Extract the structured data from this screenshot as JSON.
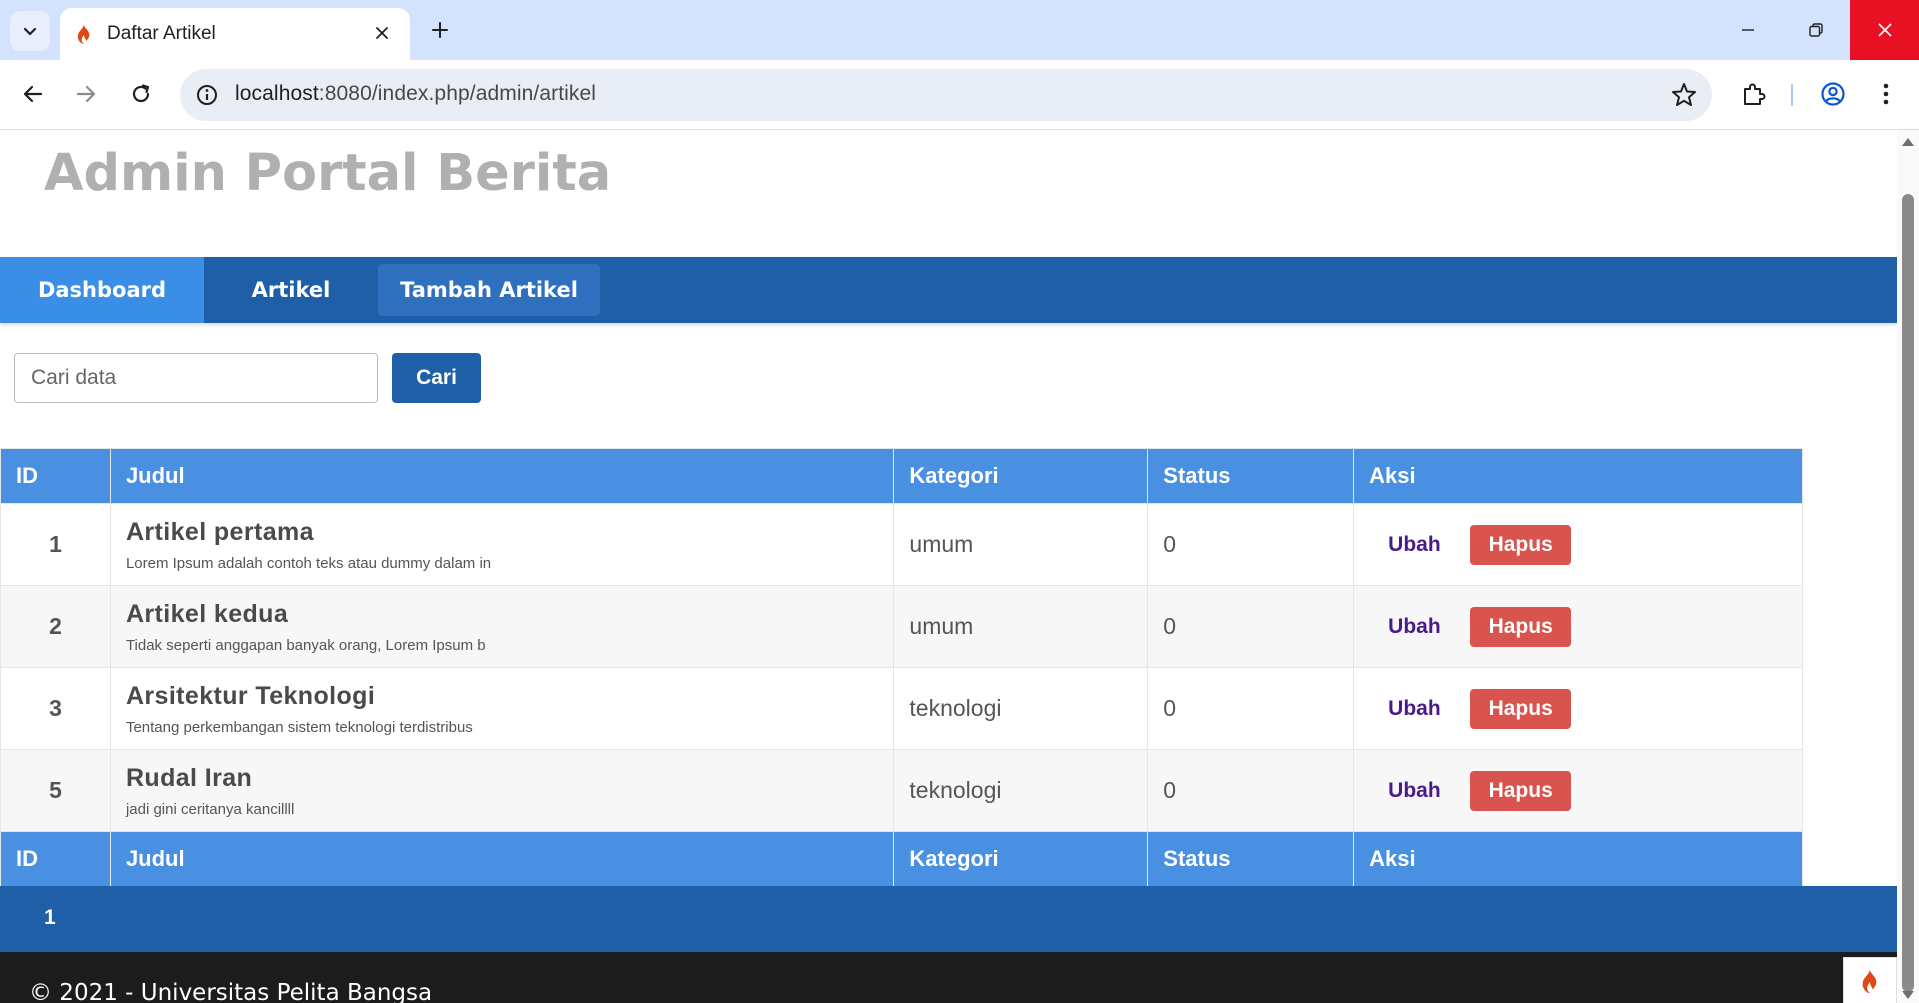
{
  "browser": {
    "tab_title": "Daftar Artikel",
    "url_host": "localhost",
    "url_rest": ":8080/index.php/admin/artikel"
  },
  "site": {
    "title": "Admin Portal Berita"
  },
  "nav": {
    "items": [
      {
        "label": "Dashboard"
      },
      {
        "label": "Artikel"
      },
      {
        "label": "Tambah Artikel"
      }
    ]
  },
  "search": {
    "placeholder": "Cari data",
    "button_label": "Cari"
  },
  "table": {
    "headers": [
      "ID",
      "Judul",
      "Kategori",
      "Status",
      "Aksi"
    ],
    "rows": [
      {
        "id": "1",
        "title": "Artikel pertama",
        "excerpt": "Lorem Ipsum adalah contoh teks atau dummy dalam in",
        "kategori": "umum",
        "status": "0",
        "edit": "Ubah",
        "delete": "Hapus"
      },
      {
        "id": "2",
        "title": "Artikel kedua",
        "excerpt": "Tidak seperti anggapan banyak orang, Lorem Ipsum b",
        "kategori": "umum",
        "status": "0",
        "edit": "Ubah",
        "delete": "Hapus"
      },
      {
        "id": "3",
        "title": "Arsitektur Teknologi",
        "excerpt": "Tentang perkembangan sistem teknologi terdistribus",
        "kategori": "teknologi",
        "status": "0",
        "edit": "Ubah",
        "delete": "Hapus"
      },
      {
        "id": "5",
        "title": "Rudal Iran",
        "excerpt": "jadi gini ceritanya kancillll",
        "kategori": "teknologi",
        "status": "0",
        "edit": "Ubah",
        "delete": "Hapus"
      }
    ]
  },
  "pagination": {
    "current_page": "1"
  },
  "footer": {
    "text": "© 2021 - Universitas Pelita Bangsa"
  },
  "colors": {
    "nav_bg": "#1f5fa8",
    "nav_active": "#3a8ee6",
    "table_header": "#4a90e2",
    "delete_button": "#d9534f",
    "edit_link": "#4b1a8a",
    "footer_bg": "#1c1c1c"
  },
  "icons": [
    "tab-list-icon",
    "codeigniter-flame-icon",
    "close-icon",
    "plus-icon",
    "minimize-icon",
    "restore-icon",
    "window-close-icon",
    "back-arrow-icon",
    "forward-arrow-icon",
    "reload-icon",
    "site-info-icon",
    "bookmark-star-icon",
    "extensions-icon",
    "profile-icon",
    "kebab-menu-icon"
  ]
}
